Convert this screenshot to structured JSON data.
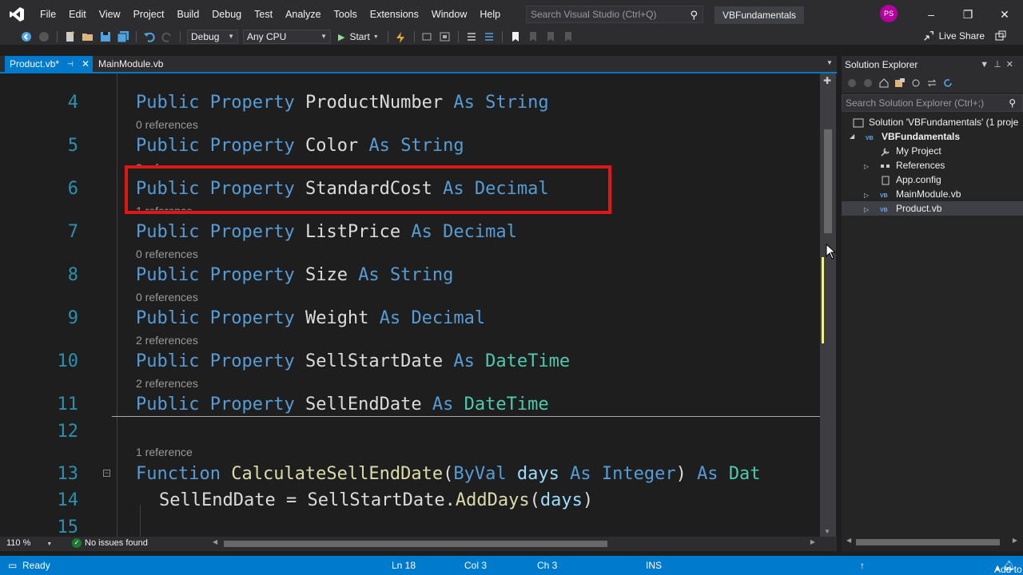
{
  "menu": {
    "items": [
      "File",
      "Edit",
      "View",
      "Project",
      "Build",
      "Debug",
      "Test",
      "Analyze",
      "Tools",
      "Extensions",
      "Window",
      "Help"
    ],
    "search_placeholder": "Search Visual Studio (Ctrl+Q)",
    "solution_name": "VBFundamentals",
    "avatar_initials": "PS"
  },
  "toolbar": {
    "configuration": "Debug",
    "platform": "Any CPU",
    "start_label": "Start",
    "live_share_label": "Live Share"
  },
  "tabs": [
    {
      "label": "Product.vb*",
      "active": true
    },
    {
      "label": "MainModule.vb",
      "active": false
    }
  ],
  "editor": {
    "lines": [
      {
        "num": "4",
        "ref_above": "",
        "tokens": "Public Property ProductNumber As String"
      },
      {
        "num": "5",
        "ref_above": "0 references",
        "tokens": "Public Property Color As String"
      },
      {
        "num": "6",
        "ref_above": "2 references",
        "tokens": "Public Property StandardCost As Decimal"
      },
      {
        "num": "7",
        "ref_above": "1 reference",
        "tokens": "Public Property ListPrice As Decimal"
      },
      {
        "num": "8",
        "ref_above": "0 references",
        "tokens": "Public Property Size As String"
      },
      {
        "num": "9",
        "ref_above": "0 references",
        "tokens": "Public Property Weight As Decimal"
      },
      {
        "num": "10",
        "ref_above": "2 references",
        "tokens": "Public Property SellStartDate As DateTime"
      },
      {
        "num": "11",
        "ref_above": "2 references",
        "tokens": "Public Property SellEndDate As DateTime"
      },
      {
        "num": "12",
        "ref_above": "",
        "tokens": ""
      },
      {
        "num": "13",
        "ref_above": "1 reference",
        "tokens": "Function CalculateSellEndDate(ByVal days As Integer) As Dat"
      },
      {
        "num": "14",
        "ref_above": "",
        "tokens": "  SellEndDate = SellStartDate.AddDays(days)"
      },
      {
        "num": "15",
        "ref_above": "",
        "tokens": ""
      }
    ],
    "kw": {
      "public": "Public",
      "property": "Property",
      "as": "As",
      "function": "Function",
      "byval": "ByVal"
    },
    "names": {
      "productnumber": "ProductNumber",
      "color": "Color",
      "standardcost": "StandardCost",
      "listprice": "ListPrice",
      "size": "Size",
      "weight": "Weight",
      "sellstartdate": "SellStartDate",
      "sellenddate": "SellEndDate",
      "calc": "CalculateSellEndDate",
      "days": "days",
      "adddays": "AddDays"
    },
    "types": {
      "string": "String",
      "decimal": "Decimal",
      "datetime": "DateTime",
      "integer": "Integer",
      "dat": "Dat"
    },
    "refs": {
      "r0": "0 references",
      "r1": "1 reference",
      "r2": "2 references"
    },
    "overlapped_refs": {
      "a": "2 references",
      "b": "1 reference"
    }
  },
  "editor_footer": {
    "zoom": "110 %",
    "issues": "No issues found"
  },
  "solution_explorer": {
    "title": "Solution Explorer",
    "search_placeholder": "Search Solution Explorer (Ctrl+;)",
    "items": {
      "solution": "Solution 'VBFundamentals' (1 proje",
      "project": "VBFundamentals",
      "my_project": "My Project",
      "references": "References",
      "app_config": "App.config",
      "main_module": "MainModule.vb",
      "product": "Product.vb"
    },
    "vb_badge": "VB"
  },
  "status": {
    "ready": "Ready",
    "ln": "Ln 18",
    "col": "Col 3",
    "ch": "Ch 3",
    "ins": "INS",
    "source_control": "Add to Source Control"
  },
  "colors": {
    "accent": "#007acc",
    "highlight_box": "#e01616",
    "keyword": "#569cd6",
    "type": "#4ec9b0"
  }
}
